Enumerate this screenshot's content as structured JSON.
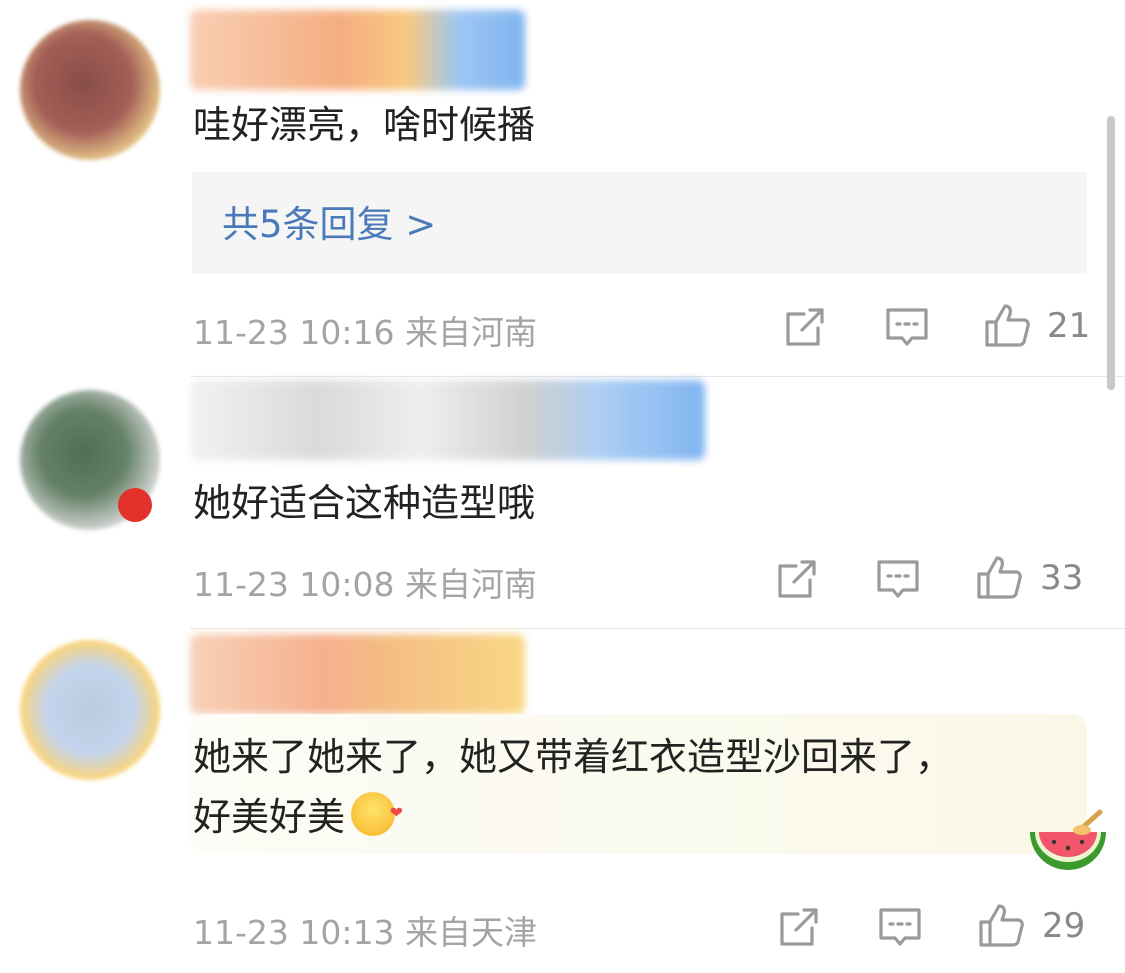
{
  "comments": [
    {
      "text": "哇好漂亮，啥时候播",
      "replies_label": "共5条回复 >",
      "time": "11-23 10:16",
      "location": "来自河南",
      "likes": "21"
    },
    {
      "text": "她好适合这种造型哦",
      "time": "11-23 10:08",
      "location": "来自河南",
      "likes": "33"
    },
    {
      "text_line1": "她来了她来了，她又带着红衣造型沙回来了，",
      "text_line2": "好美好美",
      "time": "11-23 10:13",
      "location": "来自天津",
      "likes": "29"
    }
  ],
  "icons": {
    "share": "share-icon",
    "comment": "comment-icon",
    "like": "thumbs-up-icon",
    "emoji": "hug-emoji-icon",
    "badge": "watermelon-badge-icon"
  },
  "colors": {
    "reply_link": "#4a7ab8",
    "meta_text": "#a4a4a4",
    "icon_stroke": "#9a9a9a"
  }
}
